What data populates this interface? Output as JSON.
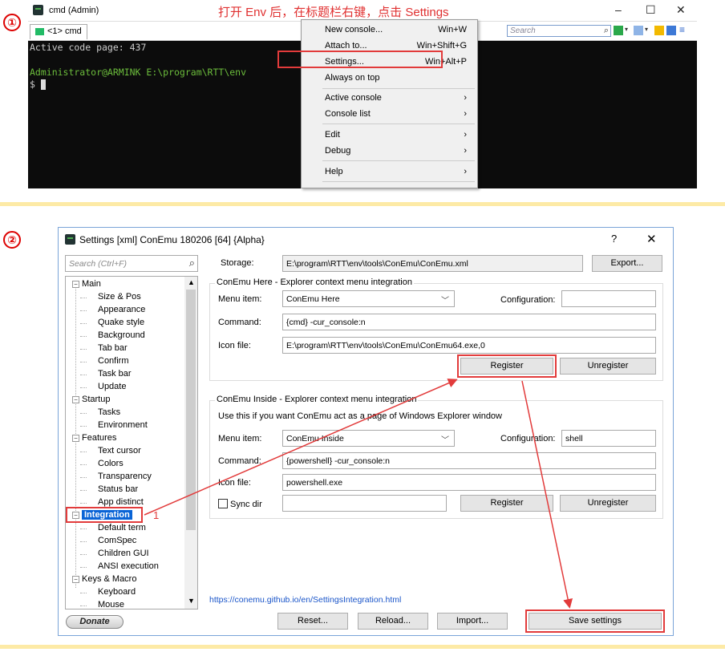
{
  "step1": {
    "badge": "①",
    "window_title": "cmd (Admin)",
    "annotation": "打开 Env 后，在标题栏右键，点击 Settings",
    "win_controls": {
      "minimize": "–",
      "maximize": "☐",
      "close": "✕"
    },
    "tab_label": "<1> cmd",
    "search_placeholder": "Search",
    "console_lines": [
      "Active code page: 437",
      "Administrator@ARMINK E:\\program\\RTT\\env",
      "$ "
    ],
    "context_menu": [
      {
        "label": "New console...",
        "shortcut": "Win+W"
      },
      {
        "label": "Attach to...",
        "shortcut": "Win+Shift+G"
      },
      {
        "label": "Settings...",
        "shortcut": "Win+Alt+P"
      },
      {
        "label": "Always on top",
        "shortcut": ""
      },
      {
        "label": "Active console",
        "shortcut": "›"
      },
      {
        "label": "Console list",
        "shortcut": "›"
      },
      {
        "label": "Edit",
        "shortcut": "›"
      },
      {
        "label": "Debug",
        "shortcut": "›"
      },
      {
        "label": "Help",
        "shortcut": "›"
      }
    ]
  },
  "step2": {
    "badge": "②",
    "dialog_title": "Settings [xml] ConEmu 180206 [64] {Alpha}",
    "help": "?",
    "close": "✕",
    "search_placeholder": "Search (Ctrl+F)",
    "storage_label": "Storage:",
    "storage_value": "E:\\program\\RTT\\env\\tools\\ConEmu\\ConEmu.xml",
    "export_label": "Export...",
    "here_group": {
      "title": "ConEmu Here - Explorer context menu integration",
      "menu_item_label": "Menu item:",
      "menu_item_value": "ConEmu Here",
      "config_label": "Configuration:",
      "config_value": "",
      "command_label": "Command:",
      "command_value": "{cmd} -cur_console:n",
      "icon_label": "Icon file:",
      "icon_value": "E:\\program\\RTT\\env\\tools\\ConEmu\\ConEmu64.exe,0",
      "register": "Register",
      "unregister": "Unregister"
    },
    "inside_group": {
      "title": "ConEmu Inside - Explorer context menu integration",
      "desc": "Use this if you want ConEmu act as a page of Windows Explorer window",
      "menu_item_label": "Menu item:",
      "menu_item_value": "ConEmu Inside",
      "config_label": "Configuration:",
      "config_value": "shell",
      "command_label": "Command:",
      "command_value": "{powershell} -cur_console:n",
      "icon_label": "Icon file:",
      "icon_value": "powershell.exe",
      "sync_label": "Sync dir",
      "sync_value": "",
      "register": "Register",
      "unregister": "Unregister"
    },
    "tree": [
      {
        "label": "Main",
        "level": 0,
        "expand": "−"
      },
      {
        "label": "Size & Pos",
        "level": 1
      },
      {
        "label": "Appearance",
        "level": 1
      },
      {
        "label": "Quake style",
        "level": 1
      },
      {
        "label": "Background",
        "level": 1
      },
      {
        "label": "Tab bar",
        "level": 1
      },
      {
        "label": "Confirm",
        "level": 1
      },
      {
        "label": "Task bar",
        "level": 1
      },
      {
        "label": "Update",
        "level": 1
      },
      {
        "label": "Startup",
        "level": 0,
        "expand": "−"
      },
      {
        "label": "Tasks",
        "level": 1
      },
      {
        "label": "Environment",
        "level": 1
      },
      {
        "label": "Features",
        "level": 0,
        "expand": "−"
      },
      {
        "label": "Text cursor",
        "level": 1
      },
      {
        "label": "Colors",
        "level": 1
      },
      {
        "label": "Transparency",
        "level": 1
      },
      {
        "label": "Status bar",
        "level": 1
      },
      {
        "label": "App distinct",
        "level": 1
      },
      {
        "label": "Integration",
        "level": 0,
        "expand": "−",
        "selected": true
      },
      {
        "label": "Default term",
        "level": 1
      },
      {
        "label": "ComSpec",
        "level": 1
      },
      {
        "label": "Children GUI",
        "level": 1
      },
      {
        "label": "ANSI execution",
        "level": 1
      },
      {
        "label": "Keys & Macro",
        "level": 0,
        "expand": "−"
      },
      {
        "label": "Keyboard",
        "level": 1
      },
      {
        "label": "Mouse",
        "level": 1
      }
    ],
    "step_marker": "1",
    "link": "https://conemu.github.io/en/SettingsIntegration.html",
    "donate": "Donate",
    "reset": "Reset...",
    "reload": "Reload...",
    "import": "Import...",
    "save": "Save settings"
  },
  "colors": {
    "annotation_red": "#e23b3b",
    "divider": "#fdeaa6",
    "selection": "#0a64d6"
  }
}
